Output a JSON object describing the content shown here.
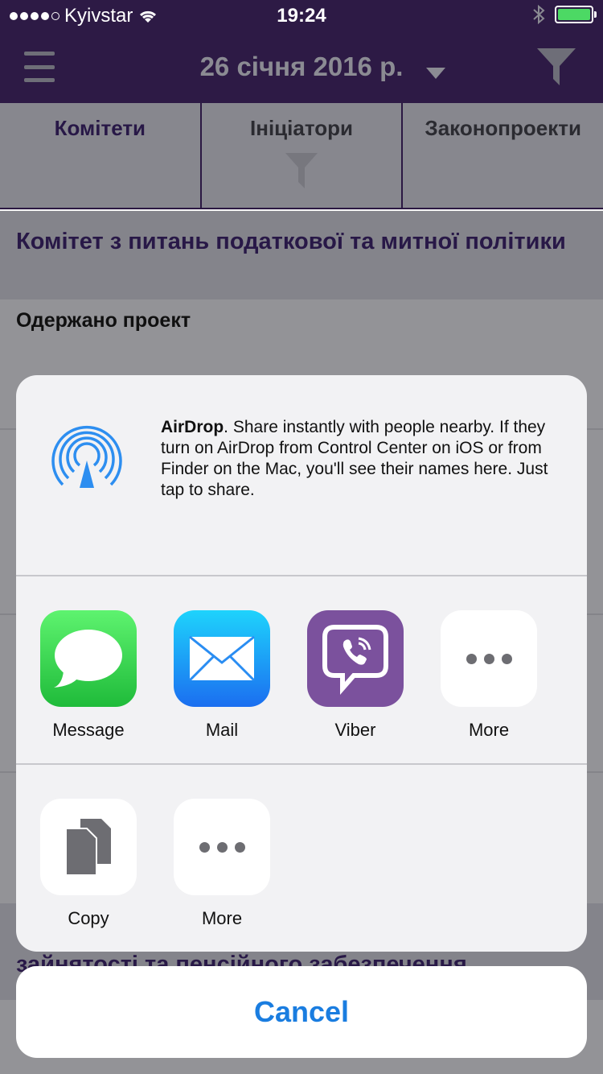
{
  "status_bar": {
    "carrier": "Kyivstar",
    "time": "19:24",
    "signal_bars": 4,
    "battery_level": 1.0
  },
  "nav": {
    "title": "26 січня 2016 р."
  },
  "tabs": [
    {
      "label": "Комітети",
      "active": true
    },
    {
      "label": "Ініціатори",
      "active": false
    },
    {
      "label": "Законопроекти",
      "active": false
    }
  ],
  "content": {
    "section_title": "Комітет з питань податкової та митної політики",
    "sub_header": "Одержано проект",
    "bottom_section_partial": "зайнятості та пенсійного забезпечення"
  },
  "share_sheet": {
    "airdrop": {
      "title": "AirDrop",
      "description": ". Share instantly with people nearby. If they turn on AirDrop from Control Center on iOS or from Finder on the Mac, you'll see their names here. Just tap to share."
    },
    "apps": [
      {
        "label": "Message",
        "icon": "message-icon"
      },
      {
        "label": "Mail",
        "icon": "mail-icon"
      },
      {
        "label": "Viber",
        "icon": "viber-icon"
      },
      {
        "label": "More",
        "icon": "more-icon"
      }
    ],
    "actions": [
      {
        "label": "Copy",
        "icon": "copy-icon"
      },
      {
        "label": "More",
        "icon": "more-icon"
      }
    ],
    "cancel_label": "Cancel"
  },
  "colors": {
    "nav_background": "#2d1a45",
    "accent_blue": "#1a7de0",
    "battery_green": "#4cd964"
  }
}
